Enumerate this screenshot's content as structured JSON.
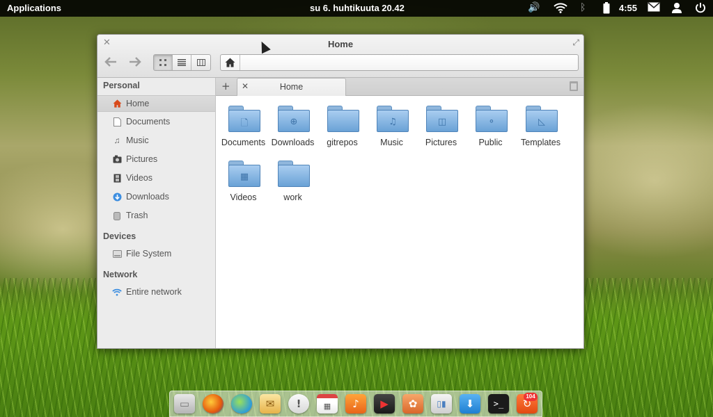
{
  "panel": {
    "apps_label": "Applications",
    "clock": "su  6. huhtikuuta 20.42",
    "battery_time": "4:55",
    "indicators": [
      "volume-icon",
      "wifi-icon",
      "bluetooth-icon",
      "battery-icon",
      "mail-icon",
      "user-icon",
      "power-icon"
    ]
  },
  "window": {
    "title": "Home",
    "nav": {
      "back": "back-arrow-icon",
      "forward": "forward-arrow-icon"
    },
    "view_modes": [
      "icon-view",
      "list-view",
      "column-view"
    ],
    "active_view": "icon-view"
  },
  "sidebar": {
    "sections": [
      {
        "label": "Personal"
      },
      {
        "label": "Devices"
      },
      {
        "label": "Network"
      }
    ],
    "personal": [
      {
        "label": "Home",
        "icon": "home-icon",
        "selected": true
      },
      {
        "label": "Documents",
        "icon": "document-icon"
      },
      {
        "label": "Music",
        "icon": "music-icon"
      },
      {
        "label": "Pictures",
        "icon": "pictures-icon"
      },
      {
        "label": "Videos",
        "icon": "videos-icon"
      },
      {
        "label": "Downloads",
        "icon": "downloads-icon"
      },
      {
        "label": "Trash",
        "icon": "trash-icon"
      }
    ],
    "devices": [
      {
        "label": "File System",
        "icon": "drive-icon"
      }
    ],
    "network": [
      {
        "label": "Entire network",
        "icon": "network-icon"
      }
    ]
  },
  "tabs": [
    {
      "label": "Home"
    }
  ],
  "folders": [
    {
      "label": "Documents",
      "emblem": "document"
    },
    {
      "label": "Downloads",
      "emblem": "download"
    },
    {
      "label": "gitrepos",
      "emblem": ""
    },
    {
      "label": "Music",
      "emblem": "music"
    },
    {
      "label": "Pictures",
      "emblem": "pictures"
    },
    {
      "label": "Public",
      "emblem": "share"
    },
    {
      "label": "Templates",
      "emblem": "template"
    },
    {
      "label": "Videos",
      "emblem": "video"
    },
    {
      "label": "work",
      "emblem": ""
    }
  ],
  "dock": {
    "apps": [
      "files",
      "firefox",
      "browser",
      "mail",
      "notifications",
      "calendar",
      "music",
      "videos",
      "shotwell",
      "switchboard",
      "downloads",
      "terminal",
      "software-updater"
    ],
    "badge": "104"
  }
}
